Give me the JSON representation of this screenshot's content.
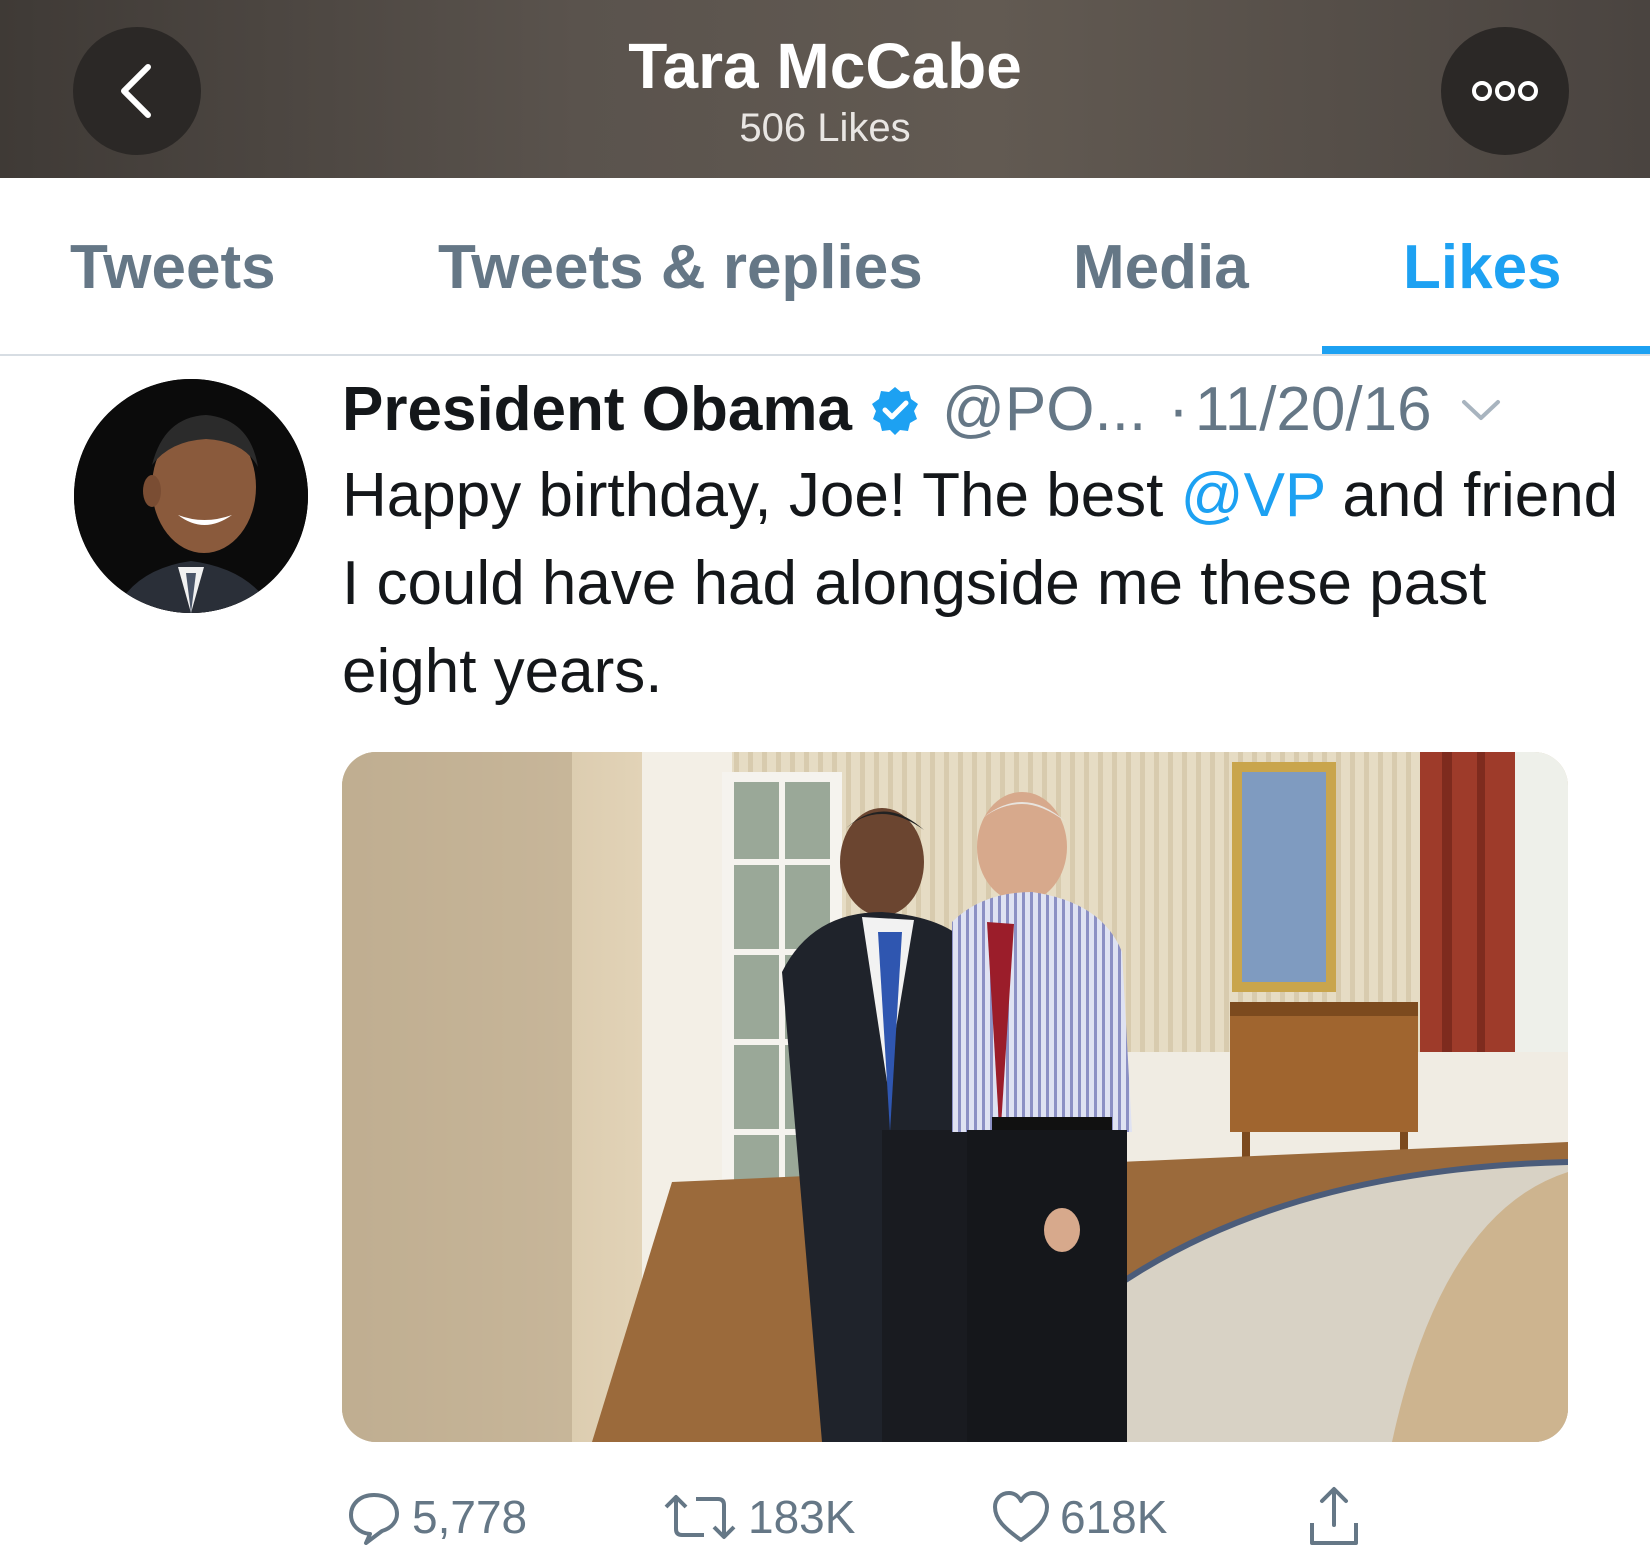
{
  "header": {
    "title": "Tara McCabe",
    "subtitle": "506 Likes"
  },
  "tabs": [
    {
      "label": "Tweets",
      "active": false
    },
    {
      "label": "Tweets & replies",
      "active": false
    },
    {
      "label": "Media",
      "active": false
    },
    {
      "label": "Likes",
      "active": true
    }
  ],
  "tweet": {
    "author": "President Obama",
    "verified": true,
    "handle": "@PO...",
    "separator": "·",
    "date": "11/20/16",
    "text_before": "Happy birthday, Joe! The best ",
    "mention": "@VP",
    "text_after": " and friend I could have had alongside me these past eight years.",
    "replies": "5,778",
    "retweets": "183K",
    "likes": "618K"
  },
  "colors": {
    "accent": "#1da1f2",
    "secondary_text": "#657786",
    "primary_text": "#14171a"
  }
}
